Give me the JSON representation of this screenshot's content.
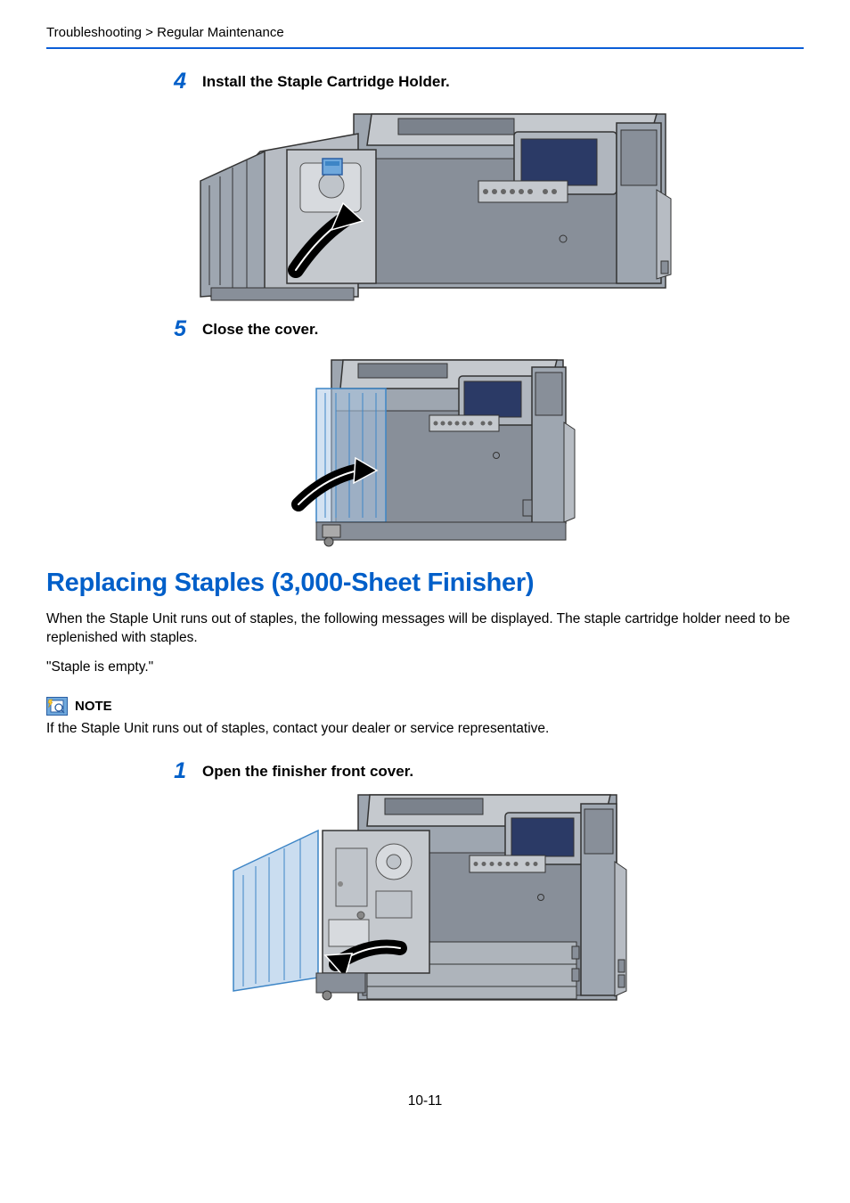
{
  "breadcrumb": "Troubleshooting > Regular Maintenance",
  "steps": {
    "s4": {
      "num": "4",
      "title": "Install the Staple Cartridge Holder."
    },
    "s5": {
      "num": "5",
      "title": "Close the cover."
    },
    "s1": {
      "num": "1",
      "title": "Open the finisher front cover."
    }
  },
  "section_title": "Replacing Staples (3,000-Sheet Finisher)",
  "para1": "When the Staple Unit runs out of staples, the following messages will be displayed. The staple cartridge holder need to be replenished with staples.",
  "para2": "\"Staple is empty.\"",
  "note": {
    "label": "NOTE",
    "text": "If the Staple Unit runs out of staples, contact your dealer or service representative."
  },
  "page_number": "10-11"
}
